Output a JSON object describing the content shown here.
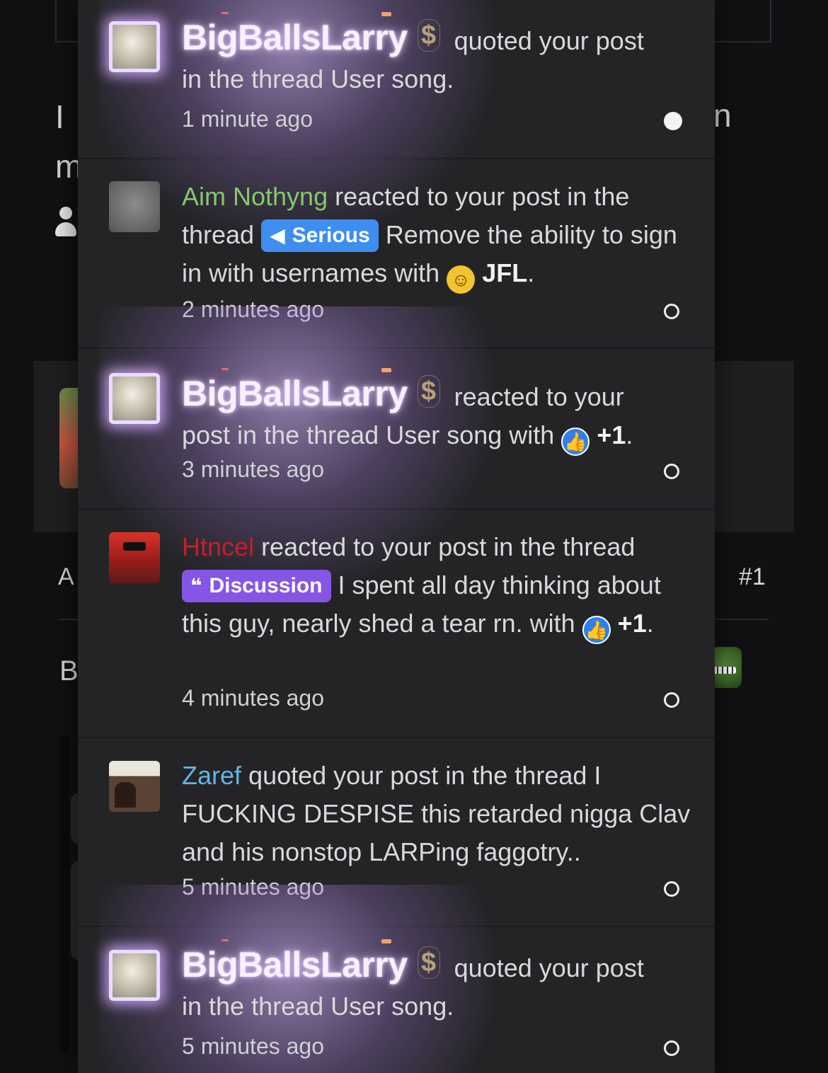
{
  "background": {
    "fragments": [
      "I",
      "n",
      "m",
      "A",
      "#1",
      "B"
    ]
  },
  "notifications": [
    {
      "user": "BigBallsLarry",
      "user_badge": "$",
      "action": "quoted your post",
      "rest": "in the thread User song.",
      "time": "1 minute ago",
      "unread": true
    },
    {
      "user": "Aim Nothyng",
      "action": "reacted to your post in the thread",
      "prefix_label": "Serious",
      "thread": "Remove the ability to sign in with usernames with",
      "reaction_icon": "laughing-crying-icon",
      "reaction": "JFL",
      "time": "2 minutes ago",
      "unread": false
    },
    {
      "user": "BigBallsLarry",
      "user_badge": "$",
      "action": "reacted to your",
      "rest": "post in the thread User song with",
      "reaction_icon": "thumbs-up-icon",
      "reaction": "+1",
      "time": "3 minutes ago",
      "unread": false
    },
    {
      "user": "Htncel",
      "action": "reacted to your post in the thread",
      "prefix_label": "Discussion",
      "thread": "I spent all day thinking about this guy, nearly shed a tear rn.",
      "with": "with",
      "reaction_icon": "thumbs-up-icon",
      "reaction": "+1",
      "time": "4 minutes ago",
      "unread": false
    },
    {
      "user": "Zaref",
      "action": "quoted your post in the thread I FUCKING DESPISE this retarded nigga Clav and his nonstop LARPing faggotry..",
      "time": "5 minutes ago",
      "unread": false
    },
    {
      "user": "BigBallsLarry",
      "user_badge": "$",
      "action": "quoted your post",
      "rest": "in the thread User song.",
      "time": "5 minutes ago",
      "unread": false
    }
  ],
  "colors": {
    "panel_bg": "#242427",
    "page_bg": "#111113",
    "username_larry_glow": "#d2aaff",
    "username_aim": "#87c76d",
    "username_htncel": "#c4202a",
    "username_zaref": "#5fb6e3",
    "badge_serious": "#3d8ef0",
    "badge_discussion": "#8556e6"
  }
}
